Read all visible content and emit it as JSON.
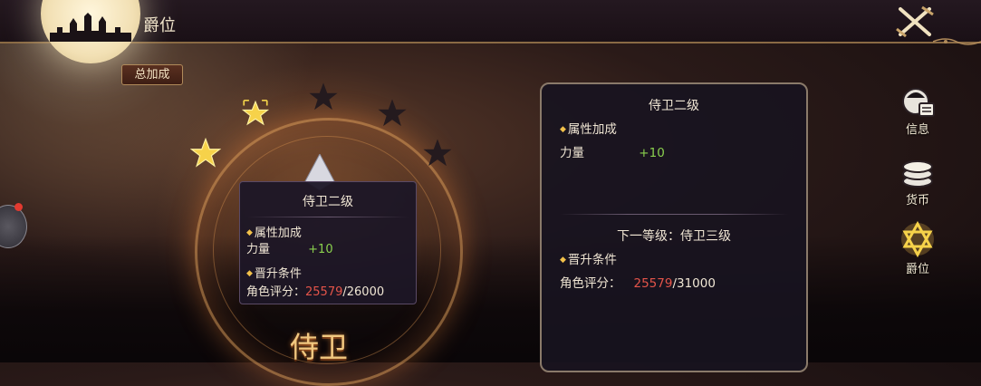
{
  "header": {
    "title": "爵位"
  },
  "buttons": {
    "total_bonus": "总加成"
  },
  "rank": {
    "name": "侍卫",
    "stars_filled": 2,
    "stars_total": 5
  },
  "tooltip": {
    "title": "侍卫二级",
    "attr_section": "属性加成",
    "attr_name": "力量",
    "attr_value": "+10",
    "promote_section": "晋升条件",
    "score_label": "角色评分：",
    "score_current": "25579",
    "score_required": "/26000"
  },
  "panel": {
    "title": "侍卫二级",
    "attr_section": "属性加成",
    "attr_name": "力量",
    "attr_value": "+10",
    "next_level": "下一等级：侍卫三级",
    "promote_section": "晋升条件",
    "score_label": "角色评分：",
    "score_current": "25579",
    "score_required": "/31000"
  },
  "sidebar": {
    "items": [
      {
        "label": "信息",
        "icon": "info-icon"
      },
      {
        "label": "货币",
        "icon": "coins-icon"
      },
      {
        "label": "爵位",
        "icon": "star-emblem-icon"
      }
    ]
  },
  "colors": {
    "gold": "#f2c14a",
    "green": "#8ad04e",
    "red": "#e4544a",
    "panel_bg": "#181420"
  }
}
